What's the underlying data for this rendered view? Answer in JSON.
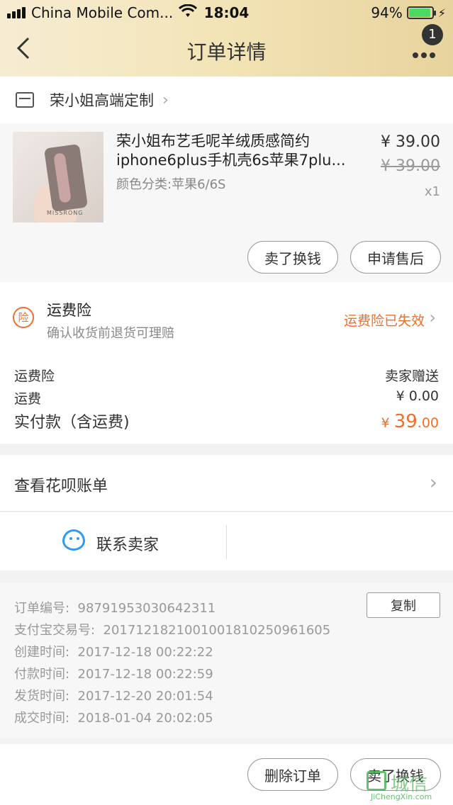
{
  "status_bar": {
    "carrier": "China Mobile Com...",
    "time": "18:04",
    "battery": "94%"
  },
  "nav": {
    "title": "订单详情",
    "badge_count": "1"
  },
  "shop": {
    "name": "荣小姐高端定制"
  },
  "product": {
    "title_line1": "荣小姐布艺毛呢羊绒质感简约",
    "title_line2": "iphone6plus手机壳6s苹果7plu...",
    "sku": "颜色分类:苹果6/6S",
    "price": "¥ 39.00",
    "original_price": "¥ 39.00",
    "quantity": "x1",
    "brand_text": "MISSRONG",
    "actions": {
      "sell": "卖了换钱",
      "after_sale": "申请售后"
    }
  },
  "insurance": {
    "icon_char": "险",
    "title": "运费险",
    "subtitle": "确认收货前退货可理赔",
    "status": "运费险已失效"
  },
  "fees": [
    {
      "label": "运费险",
      "value": "卖家赠送"
    },
    {
      "label": "运费",
      "value": "¥ 0.00"
    }
  ],
  "total": {
    "label": "实付款（含运费)",
    "currency": "¥ ",
    "integer": "39",
    "decimal": ".00"
  },
  "huabei": {
    "label": "查看花呗账单"
  },
  "contact": {
    "label": "联系卖家"
  },
  "order_info": {
    "copy_label": "复制",
    "rows": [
      {
        "label": "订单编号:",
        "value": "98791953030642311"
      },
      {
        "label": "支付宝交易号:",
        "value": "2017121821001001810250961605"
      },
      {
        "label": "创建时间:",
        "value": "2017-12-18 00:22:22"
      },
      {
        "label": "付款时间:",
        "value": "2017-12-18 00:22:59"
      },
      {
        "label": "发货时间:",
        "value": "2017-12-20 20:01:54"
      },
      {
        "label": "成交时间:",
        "value": "2018-01-04 20:02:05"
      }
    ]
  },
  "bottom_bar": {
    "delete": "删除订单",
    "sell": "卖了换钱"
  },
  "watermark": {
    "text": "城信",
    "url": "JiChengXin.com"
  },
  "colors": {
    "accent_orange": "#f06e2c",
    "header_gold": "#f3e4b6",
    "contact_blue": "#2d9cf0"
  },
  "icons": [
    "signal-icon",
    "wifi-icon",
    "battery-icon",
    "back-arrow-icon",
    "more-dots-icon",
    "store-icon",
    "chevron-right-icon",
    "insurance-icon",
    "chat-face-icon"
  ]
}
